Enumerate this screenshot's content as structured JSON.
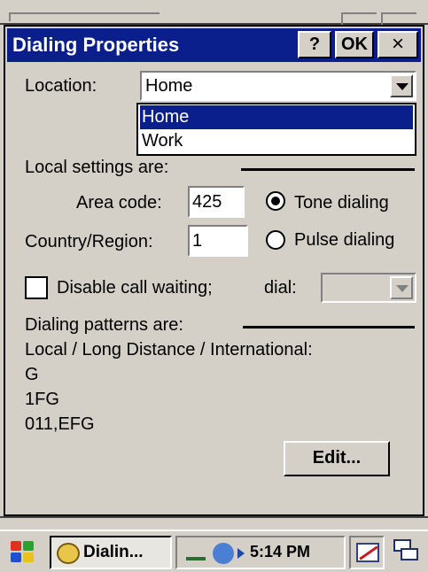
{
  "dialog": {
    "title": "Dialing Properties",
    "help_label": "?",
    "ok_label": "OK",
    "close_label": "×"
  },
  "location": {
    "label": "Location:",
    "value": "Home",
    "options": [
      "Home",
      "Work"
    ],
    "selected_index": 0
  },
  "local_settings": {
    "label": "Local settings are:",
    "area_code_label": "Area code:",
    "area_code_value": "425",
    "country_label": "Country/Region:",
    "country_value": "1",
    "tone_label": "Tone dialing",
    "pulse_label": "Pulse dialing",
    "tone_selected": true
  },
  "call_waiting": {
    "label": "Disable call waiting;",
    "checked": false,
    "dial_label": "dial:",
    "dial_value": ""
  },
  "dialing_patterns": {
    "label": "Dialing patterns are:",
    "header": "Local / Long Distance / International:",
    "local": "G",
    "long_distance": "1FG",
    "international": "011,EFG",
    "edit_label": "Edit..."
  },
  "taskbar": {
    "task_label": "Dialin...",
    "time": "5:14 PM"
  },
  "colors": {
    "titlebar": "#0a1e8c",
    "selection": "#0a1e8c",
    "face": "#d4d0c8"
  }
}
